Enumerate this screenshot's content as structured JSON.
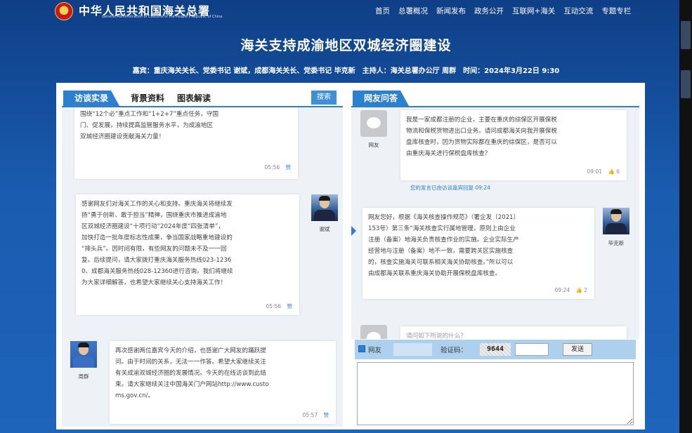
{
  "header": {
    "site_title": "中华人民共和国海关总署",
    "site_subtitle": "General Administration of Customs of the People's Republic of China",
    "nav": [
      "首页",
      "总署概况",
      "新闻发布",
      "政务公开",
      "互联网+海关",
      "互动交流",
      "专题专栏"
    ]
  },
  "page": {
    "title": "海关支持成渝地区双城经济圈建设",
    "guests": "嘉宾：重庆海关关长、党委书记 谢斌，成都海关关长、党委书记 毕克新　主持人：海关总署办公厅 周群　时间：2024年3月22日 9:30"
  },
  "left": {
    "tab_active": "访谈实录",
    "tabs": [
      "背景资料",
      "图表解读"
    ],
    "search_label": "搜索",
    "messages": [
      {
        "lines": [
          "围绕“12个必”重点工作和“1+2+7”重点任务，守国",
          "门、促发展，持续提高监管服务水平，为成渝地区",
          "双城经济圈建设贡献海关力量！"
        ],
        "time": "05:56",
        "like": "赞"
      },
      {
        "lines": [
          "感谢网友们对海关工作的关心和支持。重庆海关将继续发",
          "扬“勇于创新、敢于担当”精神，围绕重庆市推进成渝地",
          "区双城经济圈建设“十项行动”2024年度“四张清单”，",
          "加快打造一批年度标志性成果，争当国家战略重地建设的",
          "“排头兵”。因时间有限，有些网友的问题未不及一一回",
          "复。后续提问，请大家拨打重庆海关服务热线023-1236",
          "0、成都海关服务热线028-12360进行咨询。我们将继续",
          "为大家详细解答，也希望大家继续关心支持海关工作！"
        ],
        "time": "05:56",
        "like": "赞",
        "speaker": "谢斌"
      },
      {
        "lines": [
          "再次感谢两位嘉宾今天的介绍，也感谢广大网友的踊跃提",
          "问。由于时间的关系，无法一一作答。希望大家继续关注",
          "有关成渝双城经济圈的发展情况。今天的在线访谈到此结",
          "束。请大家继续关注中国海关门户网站http://www.custo",
          "ms.gov.cn/。"
        ],
        "time": "05:57",
        "like": "赞",
        "speaker": "周群"
      }
    ]
  },
  "right": {
    "tab_active": "网友问答",
    "question": {
      "user": "网友",
      "lines": [
        "我是一家成都注册的企业，主要在重庆的综保区开展保税",
        "物流和保税货物进出口业务。请问成都海关向我开展保税",
        "盘库核查时，因为货物实际都在重庆的综保区，是否可以",
        "由重庆海关进行保税盘库核查？"
      ],
      "time": "09:01",
      "likes": "6"
    },
    "notice": "您的发言已由访谈嘉宾回复 09:24",
    "answer": {
      "speaker": "毕克新",
      "lines": [
        "网友您好，根据《海关核查操作规范》（署企发〔2021〕",
        "153号）第三条“海关核查实行属地管理，原则上由企业",
        "注册（备案）地海关负责核查作业的实施。企业实际生产",
        "经营地与注册（备案）地不一致，需要跨关区实施核查",
        "的，核查实施海关可联系相关海关协助核查。”所以可以",
        "由成都海关联系重庆海关协助开展保税盘库核查。"
      ],
      "time": "09:24",
      "likes": "2"
    },
    "next_preview": "请问如下所说的什么？"
  },
  "ask_form": {
    "user_label": "网友",
    "captcha_label": "验证码：",
    "captcha_value": "9644",
    "send_label": "发送"
  }
}
